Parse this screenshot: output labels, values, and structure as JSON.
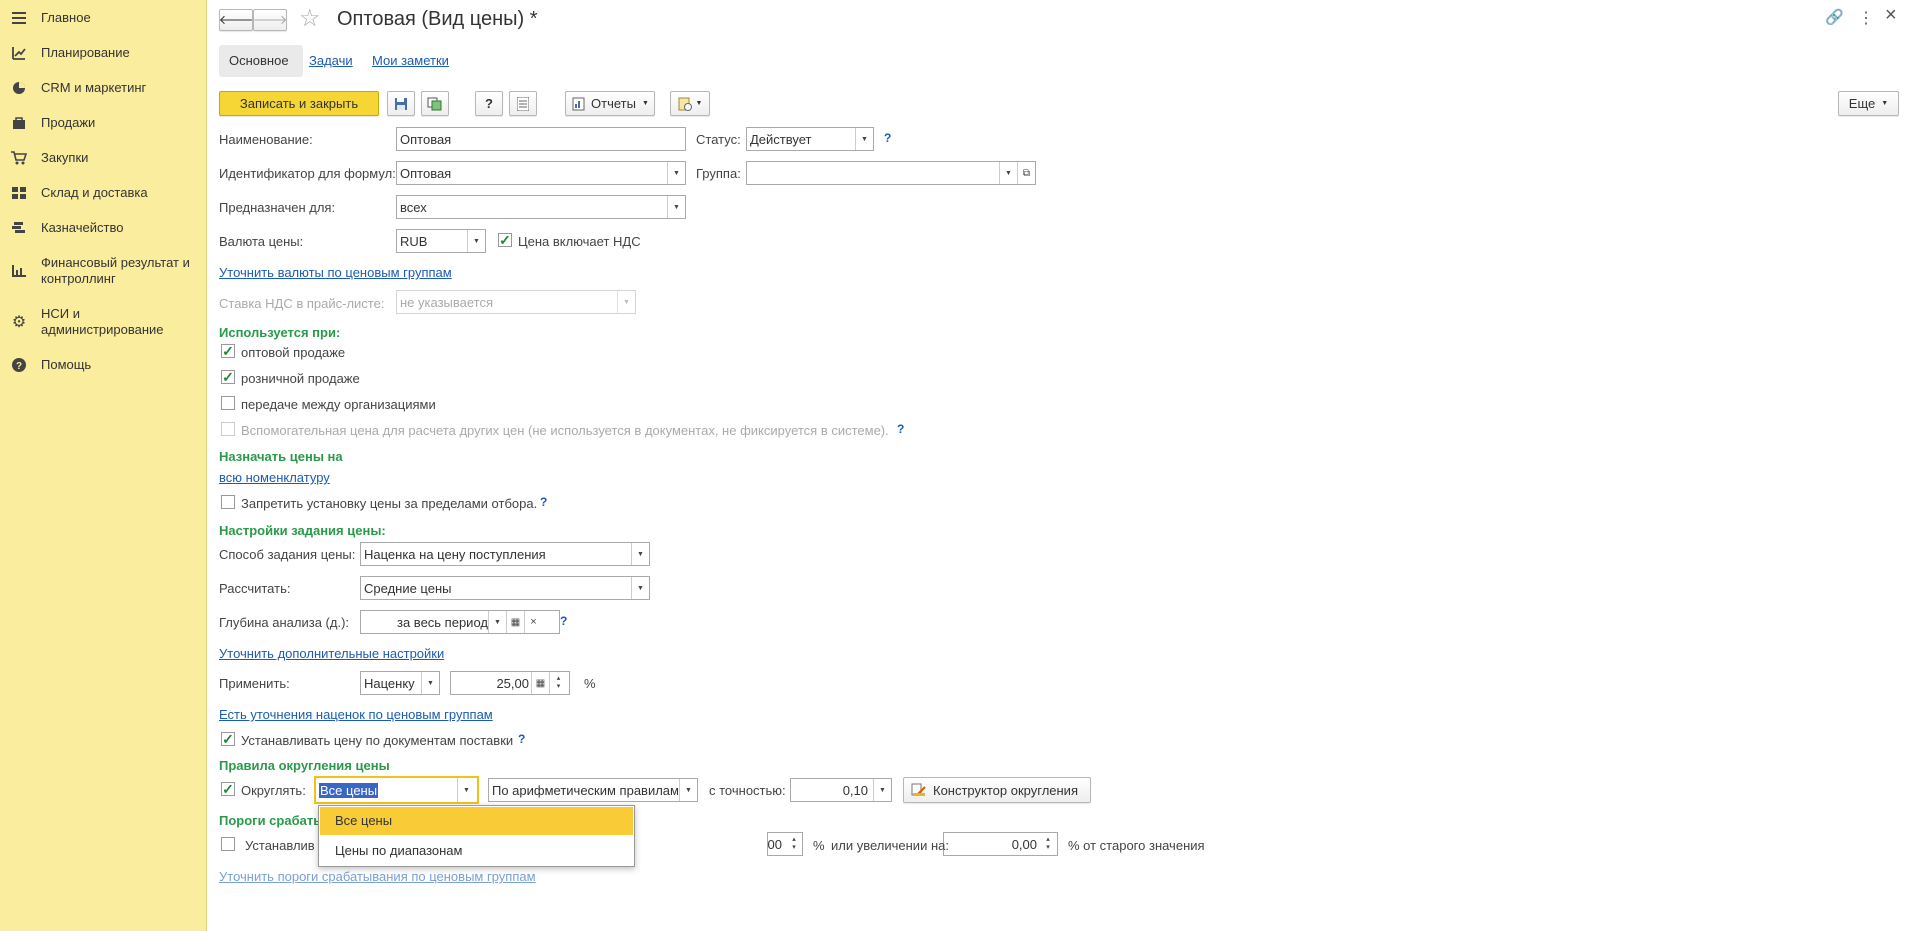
{
  "sidebar": {
    "items": [
      {
        "label": "Главное",
        "icon": "menu-icon"
      },
      {
        "label": "Планирование",
        "icon": "planning-icon"
      },
      {
        "label": "CRM и маркетинг",
        "icon": "pie-chart-icon"
      },
      {
        "label": "Продажи",
        "icon": "bag-icon"
      },
      {
        "label": "Закупки",
        "icon": "cart-icon"
      },
      {
        "label": "Склад и доставка",
        "icon": "warehouse-icon"
      },
      {
        "label": "Казначейство",
        "icon": "treasury-icon"
      },
      {
        "label": "Финансовый результат и контроллинг",
        "icon": "bar-chart-icon"
      },
      {
        "label": "НСИ и администрирование",
        "icon": "gear-icon"
      },
      {
        "label": "Помощь",
        "icon": "help-icon"
      }
    ]
  },
  "header": {
    "title": "Оптовая (Вид цены) *",
    "back_glyph": "🡐",
    "forward_glyph": "🡒",
    "star_glyph": "☆",
    "link_glyph": "🔗",
    "more_glyph": "⋮",
    "close_glyph": "×"
  },
  "tabs": [
    "Основное",
    "Задачи",
    "Мои заметки"
  ],
  "toolbar": {
    "save_close": "Записать и закрыть",
    "help": "?",
    "reports": "Отчеты",
    "more": "Еще"
  },
  "form": {
    "name_label": "Наименование:",
    "name_value": "Оптовая",
    "status_label": "Статус:",
    "status_value": "Действует",
    "id_label": "Идентификатор для формул:",
    "id_value": "Оптовая",
    "group_label": "Группа:",
    "group_value": "",
    "intended_label": "Предназначен для:",
    "intended_value": "всех",
    "currency_label": "Валюта цены:",
    "currency_value": "RUB",
    "vat_included": "Цена включает НДС",
    "currency_groups_link": "Уточнить валюты по ценовым группам",
    "vat_rate_label": "Ставка НДС в прайс-листе:",
    "vat_rate_value": "не указывается",
    "used_header": "Используется при:",
    "used": [
      {
        "label": "оптовой продаже",
        "checked": true
      },
      {
        "label": "розничной продаже",
        "checked": true
      },
      {
        "label": "передаче между организациями",
        "checked": false
      },
      {
        "label": "Вспомогательная цена для расчета других цен (не используется в документах, не фиксируется в системе).",
        "checked": false
      }
    ],
    "assign_header": "Назначать цены на",
    "assign_link": "всю номенклатуру",
    "forbid_label": "Запретить установку цены за пределами отбора.",
    "settings_header": "Настройки задания цены:",
    "method_label": "Способ задания цены:",
    "method_value": "Наценка на цену поступления",
    "calc_label": "Рассчитать:",
    "calc_value": "Средние цены",
    "depth_label": "Глубина анализа (д.):",
    "depth_value": "за весь период",
    "extra_link": "Уточнить дополнительные настройки",
    "apply_label": "Применить:",
    "apply_value": "Наценку",
    "apply_amount": "25,00",
    "percent": "%",
    "markup_link": "Есть уточнения наценок по ценовым группам",
    "set_by_docs": "Устанавливать цену по документам поставки",
    "round_header": "Правила округления цены",
    "round_label": "Округлять:",
    "round_value": "Все цены",
    "round_rule": "По арифметическим правилам",
    "precision_label": "с точностью:",
    "precision_value": "0,10",
    "round_builder": "Конструктор округления",
    "threshold_header": "Пороги срабаты",
    "threshold_set": "Устанавлив",
    "threshold_val1": "00",
    "or_increase": "или увеличении на:",
    "threshold_val2": "0,00",
    "of_old": "% от старого значения",
    "threshold_link": "Уточнить пороги срабатывания по ценовым группам"
  },
  "dropdown": {
    "options": [
      "Все цены",
      "Цены по диапазонам"
    ]
  },
  "colors": {
    "sidebar_bg": "#fbed9e",
    "primary_button": "#f5d635",
    "section_header": "#2a9a4a",
    "link": "#1c5bb3",
    "dropdown_selected": "#f9cc37"
  }
}
